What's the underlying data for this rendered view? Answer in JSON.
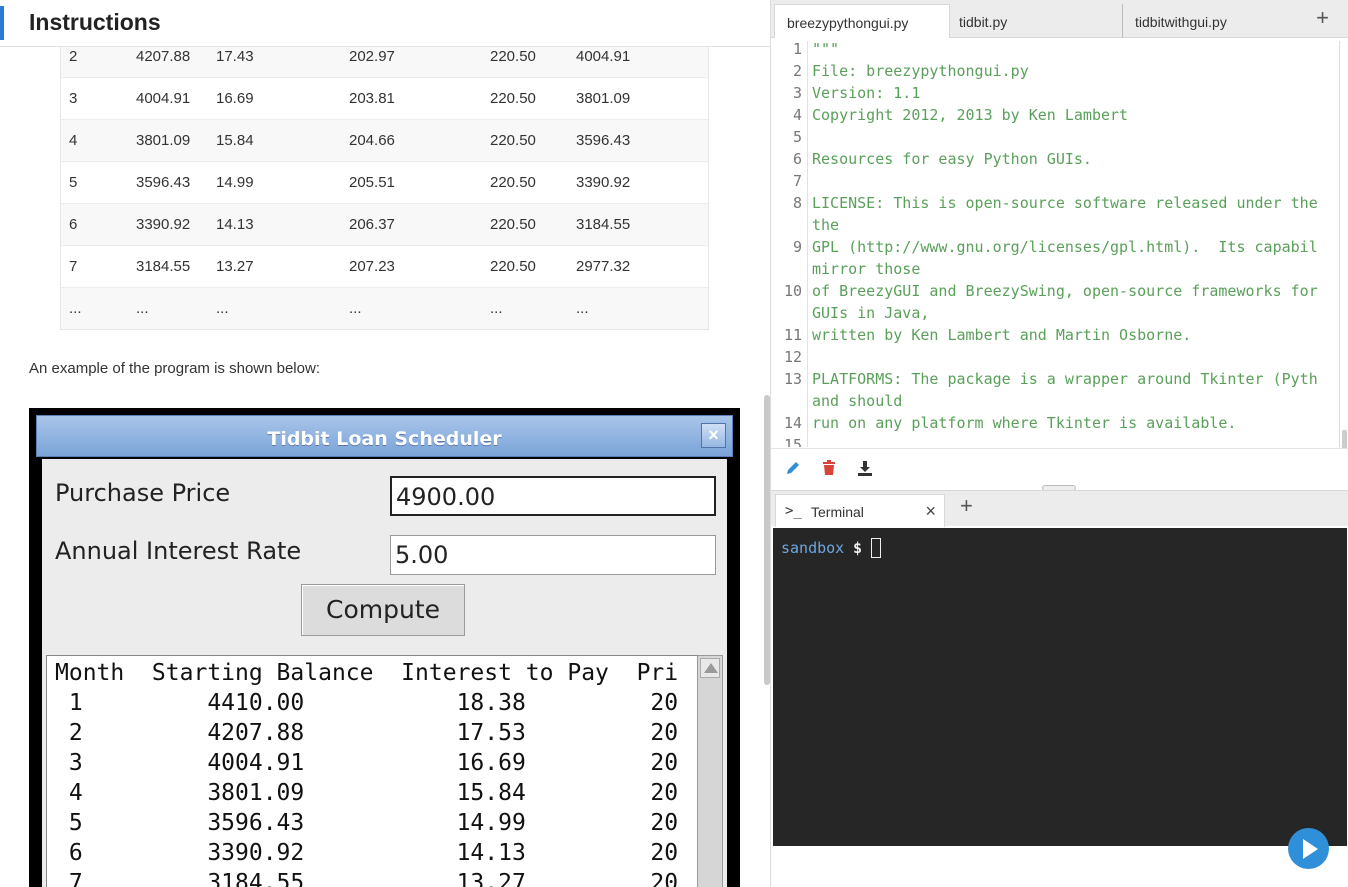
{
  "instructions": {
    "title": "Instructions",
    "table_rows": [
      [
        "2",
        "4207.88",
        "17.43",
        "202.97",
        "220.50",
        "4004.91"
      ],
      [
        "3",
        "4004.91",
        "16.69",
        "203.81",
        "220.50",
        "3801.09"
      ],
      [
        "4",
        "3801.09",
        "15.84",
        "204.66",
        "220.50",
        "3596.43"
      ],
      [
        "5",
        "3596.43",
        "14.99",
        "205.51",
        "220.50",
        "3390.92"
      ],
      [
        "6",
        "3390.92",
        "14.13",
        "206.37",
        "220.50",
        "3184.55"
      ],
      [
        "7",
        "3184.55",
        "13.27",
        "207.23",
        "220.50",
        "2977.32"
      ],
      [
        "...",
        "...",
        "...",
        "...",
        "...",
        "..."
      ]
    ],
    "example_text": "An example of the program is shown below:"
  },
  "tk_window": {
    "title": "Tidbit Loan Scheduler",
    "close_glyph": "×",
    "purchase_label": "Purchase Price",
    "purchase_value": "4900.00",
    "rate_label": "Annual Interest Rate",
    "rate_value": "5.00",
    "compute_label": "Compute",
    "output_lines": [
      "Month  Starting Balance  Interest to Pay  Pri",
      " 1         4410.00           18.38         20",
      " 2         4207.88           17.53         20",
      " 3         4004.91           16.69         20",
      " 4         3801.09           15.84         20",
      " 5         3596.43           14.99         20",
      " 6         3390.92           14.13         20",
      " 7         3184.55           13.27         20"
    ]
  },
  "editor": {
    "tabs": [
      "breezypythongui.py",
      "tidbit.py",
      "tidbitwithgui.py"
    ],
    "active_tab": 0,
    "add_tab_glyph": "+",
    "line_numbers": [
      "1",
      "2",
      "3",
      "4",
      "5",
      "6",
      "7",
      "8",
      "",
      "9",
      "",
      "10",
      "",
      "11",
      "12",
      "13",
      "",
      "14",
      "15"
    ],
    "code_lines": [
      "\"\"\"",
      "File: breezypythongui.py",
      "Version: 1.1",
      "Copyright 2012, 2013 by Ken Lambert",
      "",
      "Resources for easy Python GUIs.",
      "",
      "LICENSE: This is open-source software released under the",
      "the",
      "GPL (http://www.gnu.org/licenses/gpl.html).  Its capabil",
      "mirror those",
      "of BreezyGUI and BreezySwing, open-source frameworks for",
      "GUIs in Java,",
      "written by Ken Lambert and Martin Osborne.",
      "",
      "PLATFORMS: The package is a wrapper around Tkinter (Pyth",
      "and should",
      "run on any platform where Tkinter is available.",
      ""
    ],
    "toolbar_icons": [
      "pencil-icon",
      "trash-icon",
      "download-icon"
    ]
  },
  "terminal": {
    "tab_icon": ">_",
    "tab_label": "Terminal",
    "close_glyph": "×",
    "add_glyph": "+",
    "host": "sandbox",
    "prompt": "$"
  },
  "colors": {
    "accent": "#2b7bd6",
    "code_green": "#5aa05a",
    "terminal_bg": "#262626",
    "run_button": "#2f8fd8"
  }
}
